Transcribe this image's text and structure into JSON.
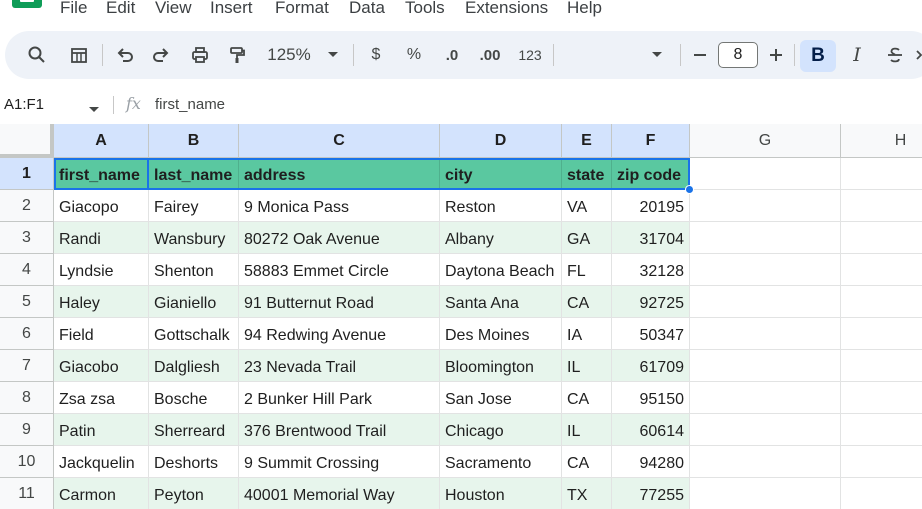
{
  "menu": [
    "File",
    "Edit",
    "View",
    "Insert",
    "Format",
    "Data",
    "Tools",
    "Extensions",
    "Help"
  ],
  "toolbar": {
    "zoom": "125%",
    "currency": "$",
    "percent": "%",
    "decrease_decimal": ".0",
    "increase_decimal": ".00",
    "number_format": "123",
    "font_size": "8",
    "bold": "B",
    "italic": "I"
  },
  "formula_bar": {
    "name_box": "A1:F1",
    "fx": "fx",
    "value": "first_name"
  },
  "columns": [
    "A",
    "B",
    "C",
    "D",
    "E",
    "F",
    "G",
    "H"
  ],
  "rows": [
    "1",
    "2",
    "3",
    "4",
    "5",
    "6",
    "7",
    "8",
    "9",
    "10",
    "11"
  ],
  "table": {
    "header": [
      "first_name",
      "last_name",
      "address",
      "city",
      "state",
      "zip code"
    ],
    "data": [
      [
        "Giacopo",
        "Fairey",
        "9 Monica Pass",
        "Reston",
        "VA",
        "20195"
      ],
      [
        "Randi",
        "Wansbury",
        "80272 Oak Avenue",
        "Albany",
        "GA",
        "31704"
      ],
      [
        "Lyndsie",
        "Shenton",
        "58883 Emmet Circle",
        "Daytona Beach",
        "FL",
        "32128"
      ],
      [
        "Haley",
        "Gianiello",
        "91 Butternut Road",
        "Santa Ana",
        "CA",
        "92725"
      ],
      [
        "Field",
        "Gottschalk",
        "94 Redwing Avenue",
        "Des Moines",
        "IA",
        "50347"
      ],
      [
        "Giacobo",
        "Dalgliesh",
        "23 Nevada Trail",
        "Bloomington",
        "IL",
        "61709"
      ],
      [
        "Zsa zsa",
        "Bosche",
        "2 Bunker Hill Park",
        "San Jose",
        "CA",
        "95150"
      ],
      [
        "Patin",
        "Sherreard",
        "376 Brentwood Trail",
        "Chicago",
        "IL",
        "60614"
      ],
      [
        "Jackquelin",
        "Deshorts",
        "9 Summit Crossing",
        "Sacramento",
        "CA",
        "94280"
      ],
      [
        "Carmon",
        "Peyton",
        "40001 Memorial Way",
        "Houston",
        "TX",
        "77255"
      ]
    ]
  },
  "colors": {
    "header_band": "#5ac8a0",
    "alt_row": "#e7f5ec",
    "selection": "#1a73e8",
    "selected_header": "#d3e3fd"
  }
}
